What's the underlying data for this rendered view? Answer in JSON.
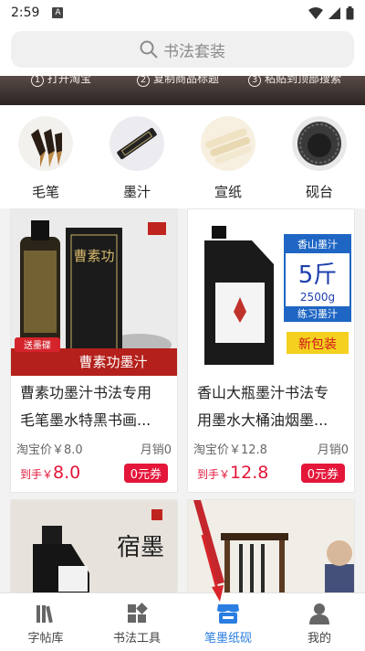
{
  "status_bar": {
    "time": "2:59",
    "notif_letter": "A"
  },
  "search": {
    "placeholder": "书法套装"
  },
  "banner": {
    "steps": [
      {
        "num": "1",
        "text": "打开淘宝"
      },
      {
        "num": "2",
        "text": "复制商品标题"
      },
      {
        "num": "3",
        "text": "粘贴到顶部搜索"
      }
    ]
  },
  "categories": [
    {
      "label": "毛笔",
      "icon": "brush-icon"
    },
    {
      "label": "墨汁",
      "icon": "ink-stick-icon"
    },
    {
      "label": "宣纸",
      "icon": "paper-icon"
    },
    {
      "label": "砚台",
      "icon": "inkstone-icon"
    }
  ],
  "products": [
    {
      "title": "曹素功墨汁书法专用毛笔墨水特黑书画...",
      "title_line1": "曹素功墨汁书法专用",
      "title_line2": "毛笔墨水特黑书画...",
      "taobao_label": "淘宝价￥8.0",
      "sales": "月销0",
      "price_prefix": "到手￥",
      "price": "8.0",
      "coupon": "0元券",
      "img_brand": "曹素功",
      "img_caption": "曹素功墨汁",
      "img_tag": "送墨碟"
    },
    {
      "title": "香山大瓶墨汁书法专用墨水大桶油烟墨...",
      "title_line1": "香山大瓶墨汁书法专",
      "title_line2": "用墨水大桶油烟墨...",
      "taobao_label": "淘宝价￥12.8",
      "sales": "月销0",
      "price_prefix": "到手￥",
      "price": "12.8",
      "coupon": "0元券",
      "img_brand": "香山墨汁",
      "img_big": "5斤",
      "img_weight": "2500g",
      "img_sub": "练习墨汁",
      "img_new": "新包装"
    },
    {
      "img_text": "宿墨"
    }
  ],
  "nav": [
    {
      "label": "字帖库",
      "icon": "book-stack-icon",
      "active": false
    },
    {
      "label": "书法工具",
      "icon": "grid-tools-icon",
      "active": false
    },
    {
      "label": "笔墨纸砚",
      "icon": "shop-icon",
      "active": true
    },
    {
      "label": "我的",
      "icon": "person-icon",
      "active": false
    }
  ],
  "colors": {
    "accent": "#e4163a",
    "active_nav": "#2a7de1"
  }
}
